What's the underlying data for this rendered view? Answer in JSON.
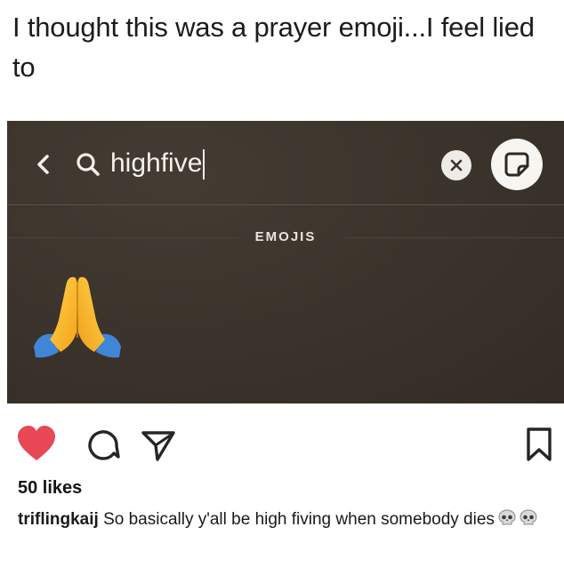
{
  "post": {
    "caption": "I thought this was a prayer emoji...I feel lied to"
  },
  "screenshot": {
    "search_query": "highfive",
    "section_label": "EMOJIS",
    "emoji_result": "folded-hands-emoji",
    "colors": {
      "background": "#3b342c",
      "text": "#f4f1ec"
    }
  },
  "actions": {
    "like_icon": "heart-icon",
    "comment_icon": "comment-icon",
    "share_icon": "share-icon",
    "save_icon": "bookmark-icon",
    "like_color": "#e84855"
  },
  "likes_text": "50 likes",
  "top_comment": {
    "username": "triflingkaij",
    "text": "So basically y'all be high fiving when somebody dies",
    "emojis": [
      "skull-emoji",
      "skull-emoji"
    ]
  }
}
